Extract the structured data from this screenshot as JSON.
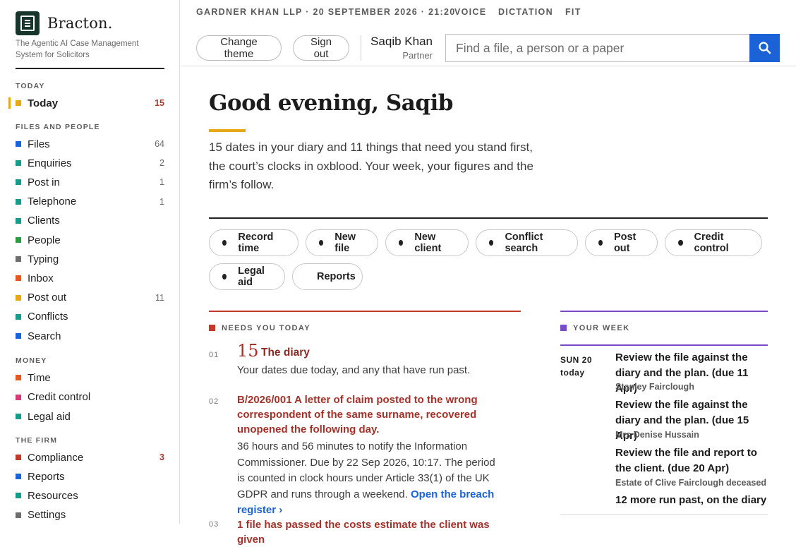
{
  "brand": {
    "name": "Bracton.",
    "tagline": "The Agentic AI Case Management System for Solicitors"
  },
  "sidebar": {
    "sections": [
      {
        "title": "TODAY",
        "items": [
          {
            "label": "Today",
            "count": "15",
            "color": "#e6a817",
            "active": true
          }
        ]
      },
      {
        "title": "FILES AND PEOPLE",
        "items": [
          {
            "label": "Files",
            "count": "64",
            "color": "#1b62d6"
          },
          {
            "label": "Enquiries",
            "count": "2",
            "color": "#1a9a8c"
          },
          {
            "label": "Post in",
            "count": "1",
            "color": "#1a9a8c"
          },
          {
            "label": "Telephone",
            "count": "1",
            "color": "#1a9a8c"
          },
          {
            "label": "Clients",
            "count": "",
            "color": "#1a9a8c"
          },
          {
            "label": "People",
            "count": "",
            "color": "#2e9a47"
          },
          {
            "label": "Typing",
            "count": "",
            "color": "#6e6e6e"
          },
          {
            "label": "Inbox",
            "count": "",
            "color": "#e4571f"
          },
          {
            "label": "Post out",
            "count": "11",
            "color": "#e6a817"
          },
          {
            "label": "Conflicts",
            "count": "",
            "color": "#1a9a8c"
          },
          {
            "label": "Search",
            "count": "",
            "color": "#1b62d6"
          }
        ]
      },
      {
        "title": "MONEY",
        "items": [
          {
            "label": "Time",
            "count": "",
            "color": "#e4571f"
          },
          {
            "label": "Credit control",
            "count": "",
            "color": "#d63a78"
          },
          {
            "label": "Legal aid",
            "count": "",
            "color": "#1a9a8c"
          }
        ]
      },
      {
        "title": "THE FIRM",
        "items": [
          {
            "label": "Compliance",
            "count": "3",
            "color": "#c0392b",
            "alert": true
          },
          {
            "label": "Reports",
            "count": "",
            "color": "#1b62d6"
          },
          {
            "label": "Resources",
            "count": "",
            "color": "#1a9a8c"
          },
          {
            "label": "Settings",
            "count": "",
            "color": "#6e6e6e"
          }
        ]
      }
    ]
  },
  "header": {
    "firm_line": "GARDNER KHAN LLP · 20 SEPTEMBER 2026 · 21:20",
    "nav": [
      "VOICE",
      "DICTATION",
      "FIT"
    ],
    "change_theme": "Change theme",
    "sign_out": "Sign out",
    "user_name": "Saqib Khan",
    "user_role": "Partner",
    "search_placeholder": "Find a file, a person or a paper"
  },
  "main": {
    "greeting": "Good evening, Saqib",
    "intro": "15 dates in your diary and 11 things that need you stand first, the court’s clocks in oxblood. Your week, your figures and the firm’s follow.",
    "actions_row1": [
      "Record time",
      "New file",
      "New client",
      "Conflict search",
      "Post out",
      "Credit control"
    ],
    "actions_row2": [
      "Legal aid",
      "Reports"
    ]
  },
  "needs_today": {
    "label": "NEEDS YOU TODAY",
    "items": [
      {
        "num": "01",
        "count": "15",
        "title": "The diary",
        "body": "Your dates due today, and any that have run past."
      },
      {
        "num": "02",
        "title": "B/2026/001 A letter of claim posted to the wrong correspondent of the same surname, recovered unopened the following day.",
        "body": "36 hours and 56 minutes to notify the Information Commissioner. Due by 22 Sep 2026, 10:17. The period is counted in clock hours under Article 33(1) of the UK GDPR and runs through a weekend.",
        "link": "Open the breach register ›"
      },
      {
        "num": "03",
        "title": "1 file has passed the costs estimate the client was given"
      }
    ]
  },
  "your_week": {
    "label": "YOUR WEEK",
    "day": "SUN 20",
    "day_sub": "today",
    "tasks": [
      {
        "title": "Review the file against the diary and the plan. (due 11 Apr)",
        "meta": "Stanley Fairclough"
      },
      {
        "title": "Review the file against the diary and the plan. (due 15 Apr)",
        "meta": "Mrs Denise Hussain"
      },
      {
        "title": "Review the file and report to the client. (due 20 Apr)",
        "meta": "Estate of Clive Fairclough deceased"
      }
    ],
    "more": "12 more run past, on the diary"
  }
}
